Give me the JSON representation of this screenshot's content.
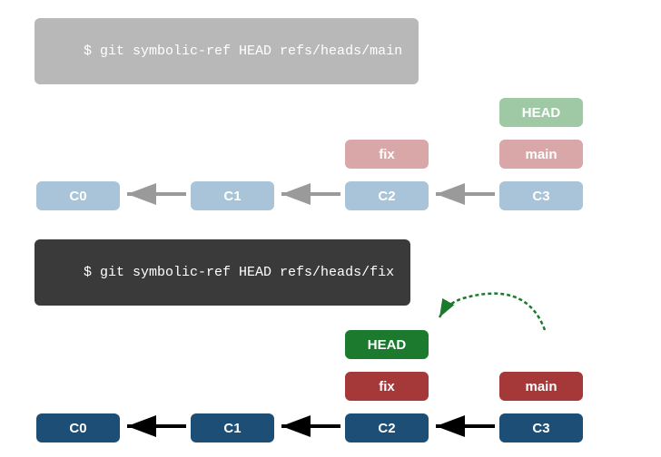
{
  "chart_data": [
    {
      "type": "diagram",
      "title": "$ git symbolic-ref HEAD refs/heads/main",
      "commits": [
        "C0",
        "C1",
        "C2",
        "C3"
      ],
      "edges": [
        [
          "C1",
          "C0"
        ],
        [
          "C2",
          "C1"
        ],
        [
          "C3",
          "C2"
        ]
      ],
      "branches": {
        "fix": "C2",
        "main": "C3"
      },
      "head_on": "main",
      "active": false
    },
    {
      "type": "diagram",
      "title": "$ git symbolic-ref HEAD refs/heads/fix",
      "commits": [
        "C0",
        "C1",
        "C2",
        "C3"
      ],
      "edges": [
        [
          "C1",
          "C0"
        ],
        [
          "C2",
          "C1"
        ],
        [
          "C3",
          "C2"
        ]
      ],
      "branches": {
        "fix": "C2",
        "main": "C3"
      },
      "head_on": "fix",
      "head_moved_from": "main",
      "active": true
    }
  ],
  "diagram1": {
    "cmd": "$ git symbolic-ref HEAD refs/heads/main",
    "head": "HEAD",
    "fix": "fix",
    "main": "main",
    "c0": "C0",
    "c1": "C1",
    "c2": "C2",
    "c3": "C3"
  },
  "diagram2": {
    "cmd": "$ git symbolic-ref HEAD refs/heads/fix",
    "head": "HEAD",
    "fix": "fix",
    "main": "main",
    "c0": "C0",
    "c1": "C1",
    "c2": "C2",
    "c3": "C3"
  }
}
